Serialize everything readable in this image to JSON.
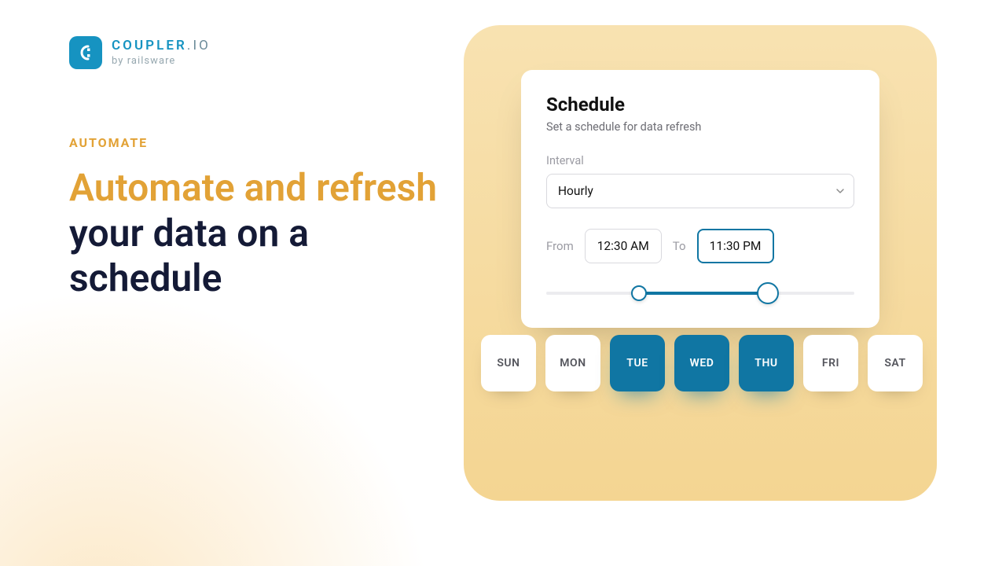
{
  "brand": {
    "name_main": "COUPLER",
    "name_suffix": ".IO",
    "tagline": "by railsware"
  },
  "left": {
    "eyebrow": "AUTOMATE",
    "headline_accent": "Automate and refresh",
    "headline_rest": " your data on a schedule"
  },
  "panel": {
    "title": "Schedule",
    "subtitle": "Set a schedule for data refresh",
    "interval_label": "Interval",
    "interval_value": "Hourly",
    "from_label": "From",
    "from_value": "12:30 AM",
    "to_label": "To",
    "to_value": "11:30 PM",
    "slider_start_pct": 30,
    "slider_end_pct": 72
  },
  "days": [
    {
      "label": "SUN",
      "selected": false
    },
    {
      "label": "MON",
      "selected": false
    },
    {
      "label": "TUE",
      "selected": true
    },
    {
      "label": "WED",
      "selected": true
    },
    {
      "label": "THU",
      "selected": true
    },
    {
      "label": "FRI",
      "selected": false
    },
    {
      "label": "SAT",
      "selected": false
    }
  ]
}
